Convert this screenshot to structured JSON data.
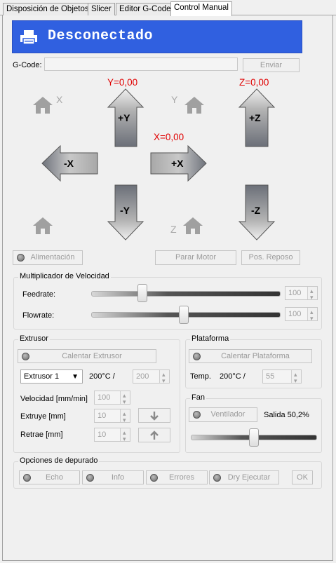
{
  "tabs": [
    {
      "label": "Disposición de Objetos"
    },
    {
      "label": "Slicer"
    },
    {
      "label": "Editor G-Code"
    },
    {
      "label": "Control Manual"
    }
  ],
  "status": {
    "text": "Desconectado",
    "color": "#3060e0",
    "icon": "printer-icon"
  },
  "gcode": {
    "label": "G-Code:",
    "value": "",
    "send_label": "Enviar"
  },
  "positions": {
    "x": "X=0,00",
    "y": "Y=0,00",
    "z": "Z=0,00"
  },
  "jog": {
    "plus_y": "+Y",
    "minus_y": "-Y",
    "plus_x": "+X",
    "minus_x": "-X",
    "plus_z": "+Z",
    "minus_z": "-Z"
  },
  "home": {
    "x_label": "X",
    "y_label": "Y",
    "z_label": "Z",
    "icon": "home-icon"
  },
  "buttons": {
    "power": "Alimentación",
    "stop_motor": "Parar Motor",
    "rest_pos": "Pos. Reposo"
  },
  "speed": {
    "title": "Multiplicador de Velocidad",
    "feedrate_label": "Feedrate:",
    "feedrate_value": "100",
    "feedrate_level": 0.27,
    "flowrate_label": "Flowrate:",
    "flowrate_value": "100",
    "flowrate_level": 0.49
  },
  "extruder": {
    "title": "Extrusor",
    "heat_label": "Calentar Extrusor",
    "select_value": "Extrusor 1",
    "temp_current": "200°C /",
    "temp_target": "200",
    "speed_label": "Velocidad [mm/min]",
    "speed_value": "100",
    "extrude_label": "Extruye [mm]",
    "extrude_value": "10",
    "retract_label": "Retrae [mm]",
    "retract_value": "10"
  },
  "platform": {
    "title": "Plataforma",
    "heat_label": "Calentar Plataforma",
    "temp_label": "Temp.",
    "temp_current": "200°C /",
    "temp_target": "55"
  },
  "fan": {
    "title": "Fan",
    "button_label": "Ventilador",
    "output_text": "Salida 50,2%",
    "level": 0.502
  },
  "debug": {
    "title": "Opciones de depurado",
    "echo": "Echo",
    "info": "Info",
    "errors": "Errores",
    "dry_run": "Dry Ejecutar",
    "ok": "OK"
  }
}
